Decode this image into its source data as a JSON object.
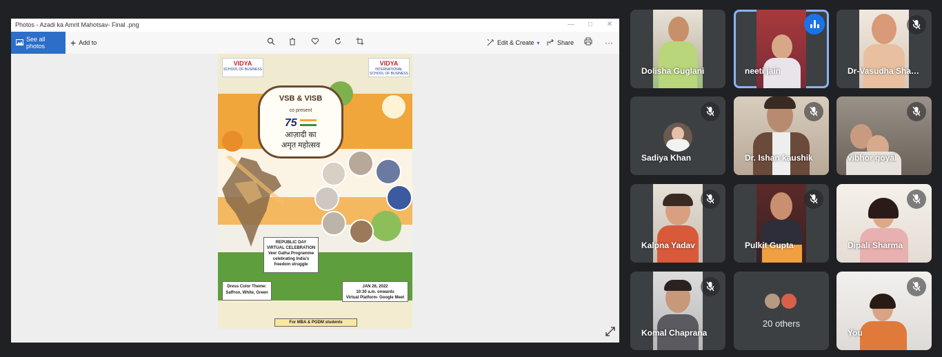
{
  "window": {
    "title": "Photos - Azadi ka Amrit Mahotsav- Final .png",
    "see_all_label": "See all photos",
    "add_to_label": "Add to",
    "edit_label": "Edit & Create",
    "share_label": "Share",
    "minimize": "—",
    "maximize": "□",
    "close": "✕",
    "more": "···"
  },
  "poster": {
    "logo_left_brand": "VIDYA",
    "logo_left_sub": "SCHOOL OF BUSINESS",
    "logo_right_brand": "VIDYA",
    "logo_right_sub": "INTERNATIONAL SCHOOL OF BUSINESS",
    "heading": "VSB & VISB",
    "co_present": "co present",
    "seventy": "75",
    "azadi_line1": "आज़ादी का",
    "azadi_line2": "अमृत महोत्सव",
    "event_line1": "REPUBLIC DAY",
    "event_line2": "VIRTUAL CELEBRATION",
    "event_line3": "Veer Gatha Programme",
    "event_line4": "celebrating India's",
    "event_line5": "freedom struggle",
    "dress_line1": "Dress Color Theme:",
    "dress_line2": "Saffron, White, Green",
    "date_line1": "JAN 26, 2022",
    "date_line2": "10:30 a.m. onwards",
    "date_line3": "Virtual Platform- Google Meet",
    "footer": "For MBA & PGDM students",
    "colors": {
      "saffron": "#f0a63a",
      "green": "#5e9e3c",
      "cream": "#f3ecd0"
    }
  },
  "participants": [
    {
      "name": "Dolisha Guglani",
      "mic": "active-none"
    },
    {
      "name": "neeti jain",
      "mic": "speaking"
    },
    {
      "name": "Dr-Vasudha Sharma",
      "mic": "muted"
    },
    {
      "name": "Sadiya Khan",
      "mic": "muted"
    },
    {
      "name": "Dr. Ishan kaushik",
      "mic": "muted"
    },
    {
      "name": "vibhor goyal",
      "mic": "muted"
    },
    {
      "name": "Kalpna Yadav",
      "mic": "muted"
    },
    {
      "name": "Pulkit Gupta",
      "mic": "muted"
    },
    {
      "name": "Dipali Sharma",
      "mic": "muted"
    },
    {
      "name": "Komal Chaprana",
      "mic": "muted"
    },
    {
      "name": "You",
      "mic": "muted"
    }
  ],
  "others": {
    "label": "20 others"
  },
  "accent": "#1a73e8"
}
